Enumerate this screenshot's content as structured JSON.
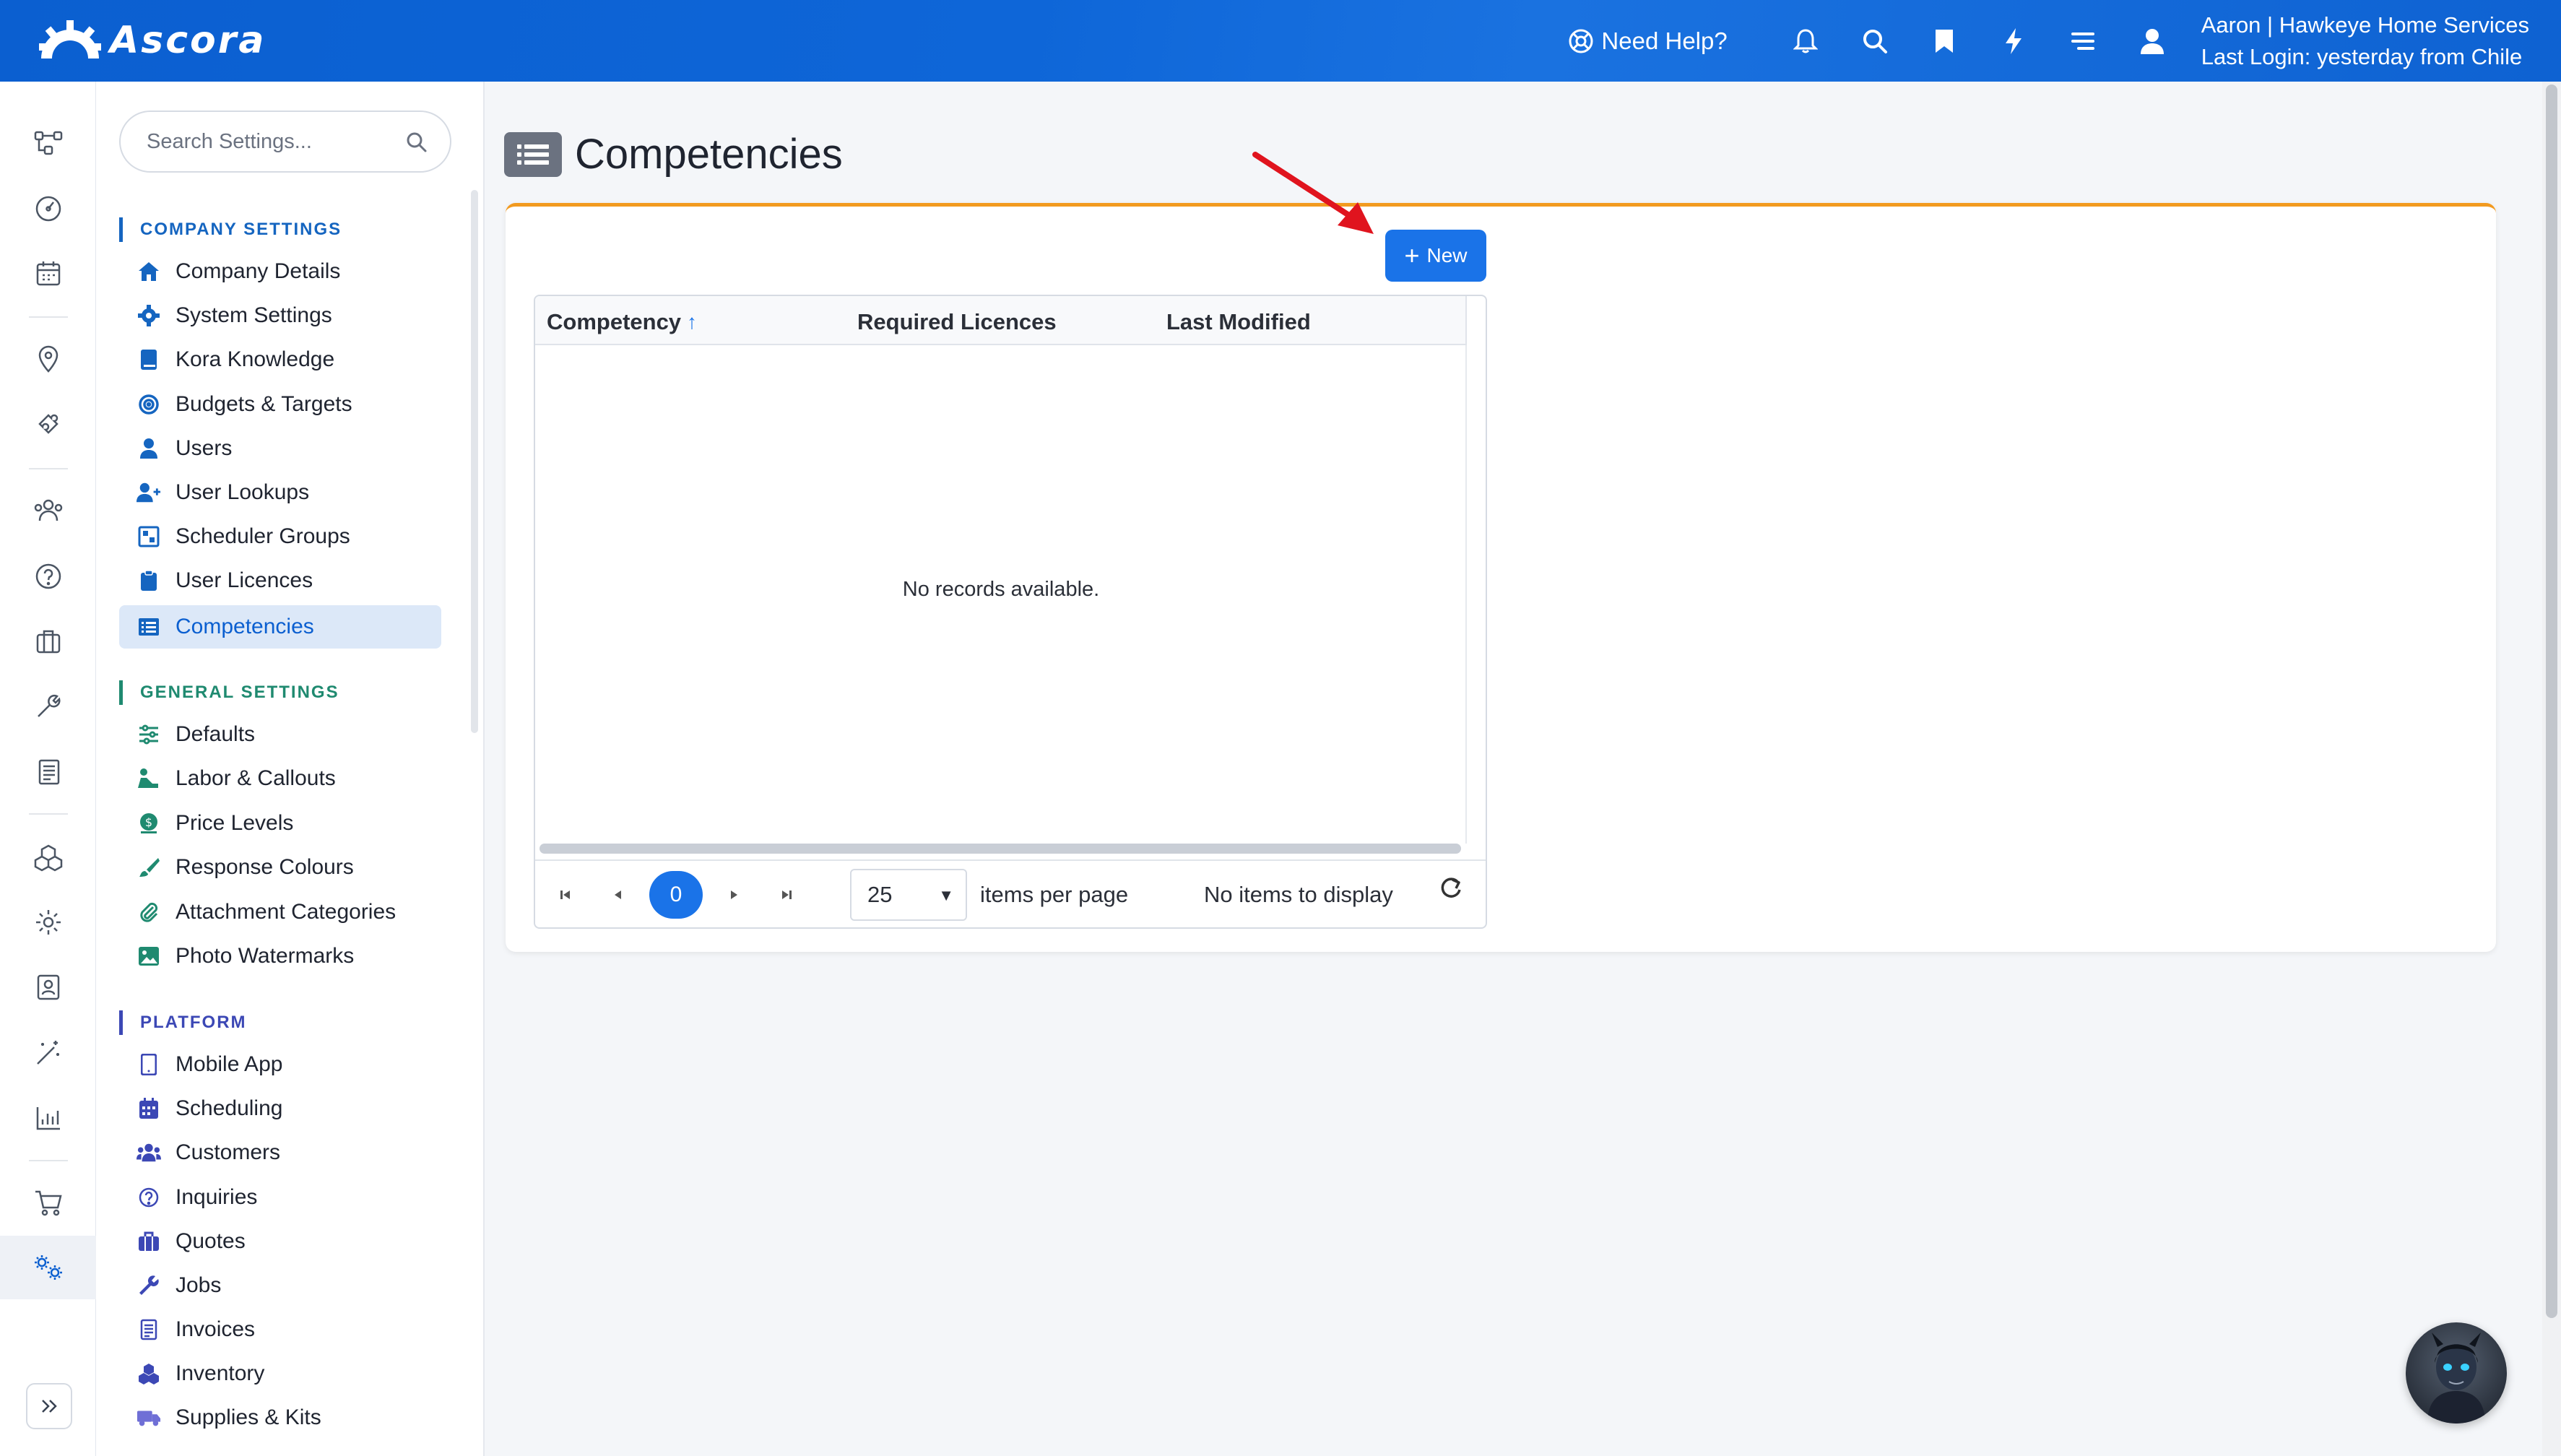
{
  "app": {
    "name": "Ascora"
  },
  "topbar": {
    "help_label": "Need Help?",
    "user_line1": "Aaron | Hawkeye Home Services",
    "user_line2": "Last Login: yesterday from Chile",
    "icons": [
      "bell-icon",
      "search-icon",
      "bookmark-icon",
      "lightning-icon",
      "menu-icon",
      "user-icon"
    ]
  },
  "rail": {
    "icons": [
      "workflow-icon",
      "dashboard-icon",
      "calendar-icon",
      "map-pin-icon",
      "puzzle-icon",
      "users-icon",
      "question-icon",
      "briefcase-icon",
      "wrench-icon",
      "invoice-icon",
      "boxes-icon",
      "gear-icon",
      "contact-card-icon",
      "magic-wand-icon",
      "bar-chart-icon",
      "cart-icon",
      "settings-cogs-icon"
    ],
    "active": "settings-cogs-icon"
  },
  "sidebar": {
    "search_placeholder": "Search Settings...",
    "sections": [
      {
        "title": "COMPANY SETTINGS",
        "items": [
          {
            "label": "Company Details",
            "icon": "home-icon"
          },
          {
            "label": "System Settings",
            "icon": "gear-icon"
          },
          {
            "label": "Kora Knowledge",
            "icon": "book-icon"
          },
          {
            "label": "Budgets & Targets",
            "icon": "target-icon"
          },
          {
            "label": "Users",
            "icon": "user-icon"
          },
          {
            "label": "User Lookups",
            "icon": "user-plus-icon"
          },
          {
            "label": "Scheduler Groups",
            "icon": "scheduler-icon"
          },
          {
            "label": "User Licences",
            "icon": "clipboard-icon"
          },
          {
            "label": "Competencies",
            "icon": "list-icon",
            "active": true
          }
        ]
      },
      {
        "title": "GENERAL SETTINGS",
        "items": [
          {
            "label": "Defaults",
            "icon": "sliders-icon"
          },
          {
            "label": "Labor & Callouts",
            "icon": "worker-icon"
          },
          {
            "label": "Price Levels",
            "icon": "dollar-icon"
          },
          {
            "label": "Response Colours",
            "icon": "brush-icon"
          },
          {
            "label": "Attachment Categories",
            "icon": "paperclip-icon"
          },
          {
            "label": "Photo Watermarks",
            "icon": "image-icon"
          }
        ]
      },
      {
        "title": "PLATFORM",
        "items": [
          {
            "label": "Mobile App",
            "icon": "mobile-icon"
          },
          {
            "label": "Scheduling",
            "icon": "calendar-icon"
          },
          {
            "label": "Customers",
            "icon": "users-icon"
          },
          {
            "label": "Inquiries",
            "icon": "question-icon"
          },
          {
            "label": "Quotes",
            "icon": "briefcase-icon"
          },
          {
            "label": "Jobs",
            "icon": "wrench-icon"
          },
          {
            "label": "Invoices",
            "icon": "invoice-icon"
          },
          {
            "label": "Inventory",
            "icon": "boxes-icon"
          },
          {
            "label": "Supplies & Kits",
            "icon": "truck-icon"
          }
        ]
      }
    ]
  },
  "main": {
    "title": "Competencies",
    "new_button": "New",
    "grid": {
      "columns": [
        "Competency",
        "Required Licences",
        "Last Modified"
      ],
      "sorted_column": "Competency",
      "empty_message": "No records available.",
      "pager": {
        "current_page": "0",
        "page_size": "25",
        "per_page_label": "items per page",
        "info": "No items to display"
      }
    }
  },
  "colors": {
    "topbar": "#0e66d8",
    "accent": "#1a73e8",
    "card_top_border": "#f29a1f",
    "active_nav_bg": "#dce8f8",
    "annotation_arrow": "#e0141e"
  }
}
